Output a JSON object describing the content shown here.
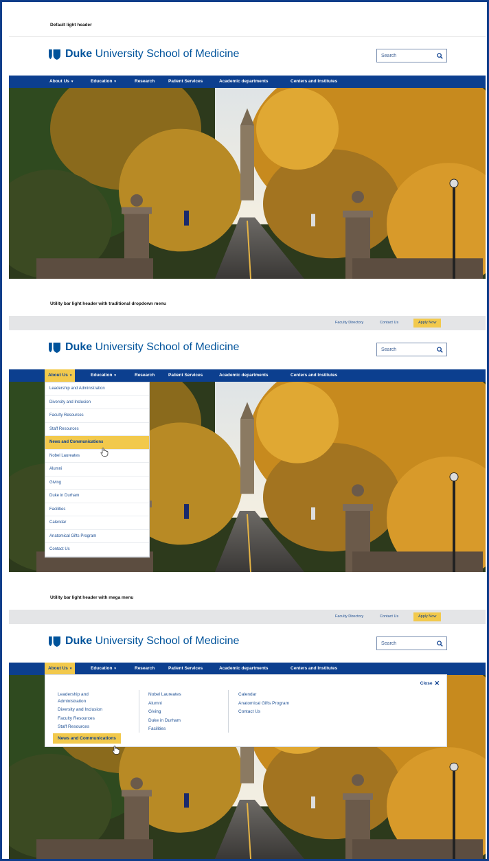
{
  "brand": {
    "name_bold": "Duke",
    "name_rest": " University School of Medicine",
    "logo_icon": "duke-shield-icon"
  },
  "search": {
    "placeholder": "Search",
    "icon": "search-icon"
  },
  "nav": {
    "items": [
      {
        "label": "About Us",
        "has_caret": true
      },
      {
        "label": "Education",
        "has_caret": true
      },
      {
        "label": "Research",
        "has_caret": false
      },
      {
        "label": "Patient Services",
        "has_caret": false
      },
      {
        "label": "Academic departments",
        "has_caret": false
      },
      {
        "label": "Centers and Institutes",
        "has_caret": false
      }
    ],
    "caret": "▾"
  },
  "sections": {
    "s1": {
      "label": "Default light header"
    },
    "s2": {
      "label": "Utility bar light header with traditional dropdown menu"
    },
    "s3": {
      "label": "Utility bar light header with mega menu"
    }
  },
  "utility": {
    "faculty_directory": "Faculty Directory",
    "contact_us": "Contact Us",
    "apply_now": "Apply Now"
  },
  "dropdown": {
    "items": [
      "Leadership and Administration",
      "Diversity and Inclusion",
      "Faculty Resources",
      "Staff Resources",
      "News and Communications",
      "Nobel Laureates",
      "Alumni",
      "Giving",
      "Duke in Durham",
      "Facilities",
      "Calendar",
      "Anatomical Gifts Program",
      "Contact Us"
    ],
    "active_index": 4
  },
  "mega": {
    "close_label": "Close",
    "col1": [
      "Leadership and",
      "Administration",
      "Diversity and Inclusion",
      "Faculty Resources",
      "Staff Resources"
    ],
    "col1_active": "News and Communications",
    "col2": [
      "Nobel Laureates",
      "Alumni",
      "Giving",
      "Duke in Durham",
      "Facilities"
    ],
    "col3": [
      "Calendar",
      "Anatomical Gifts Program",
      "Contact Us"
    ]
  },
  "colors": {
    "duke_blue": "#0c3f8f",
    "accent_yellow": "#f2c94c",
    "utility_gray": "#e4e5e7"
  }
}
